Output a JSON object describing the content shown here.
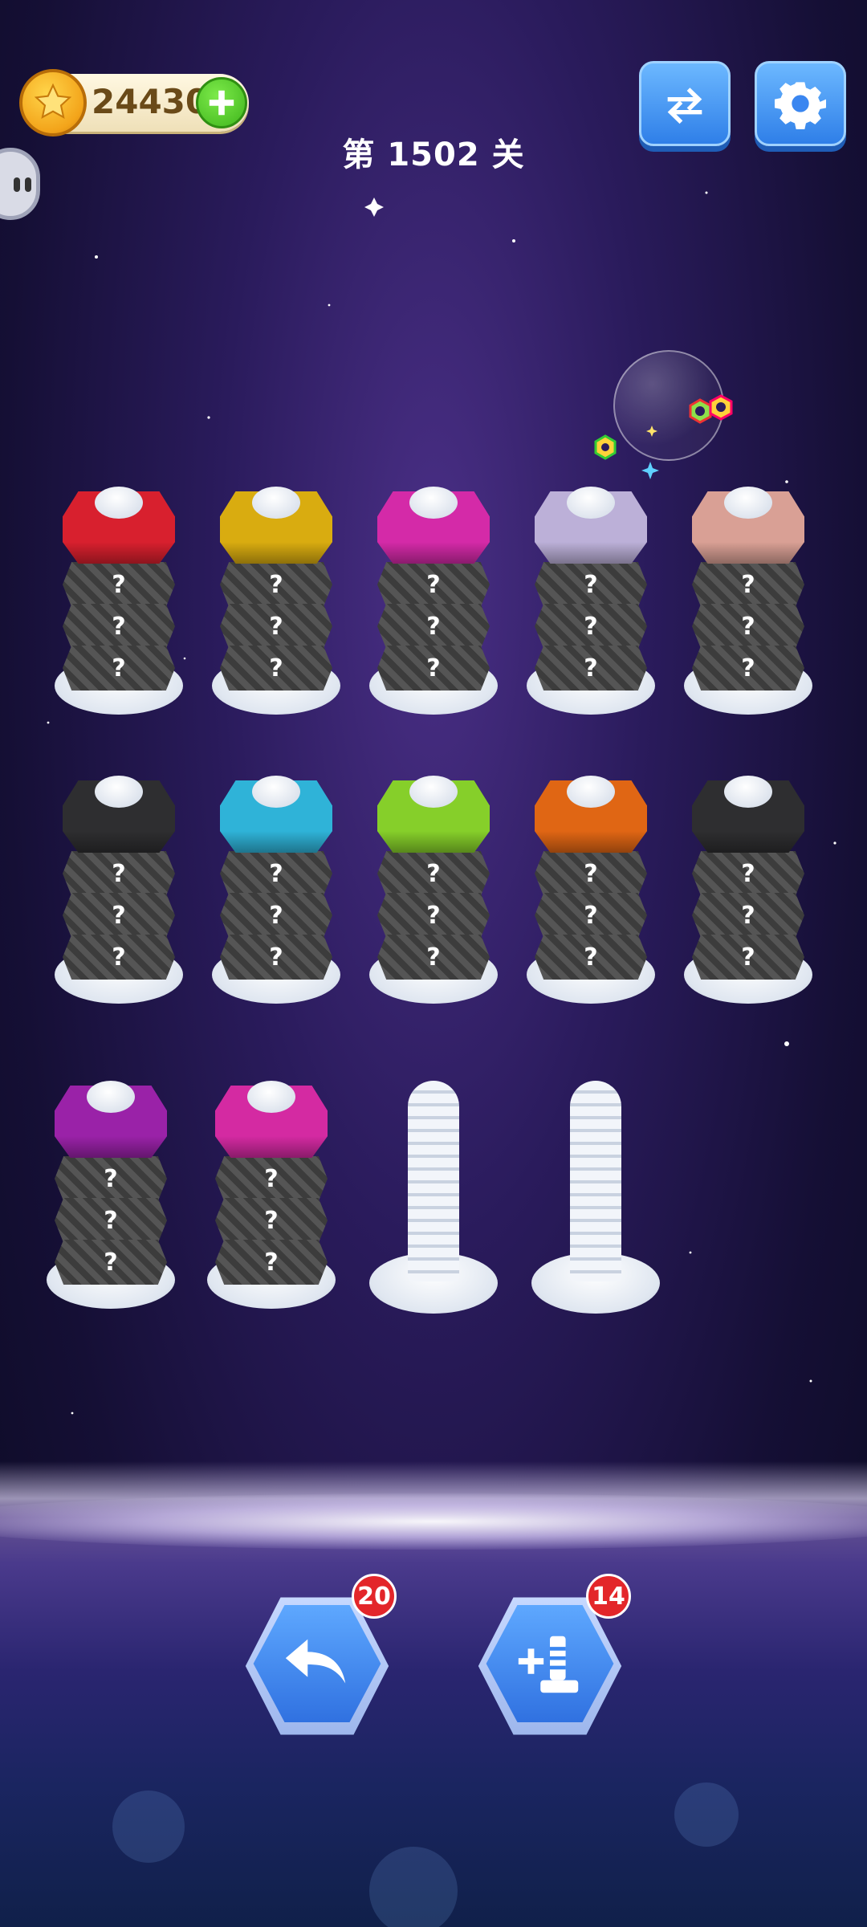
{
  "header": {
    "coins": "24430",
    "level_title": "第 1502 关"
  },
  "icons": {
    "coin": "star-coin-icon",
    "add_coins": "plus-icon",
    "side_menu": "side-menu-tab",
    "refresh": "refresh-icon",
    "settings": "gear-icon",
    "undo": "undo-icon",
    "add_screw": "add-screw-icon"
  },
  "board": {
    "screws": [
      {
        "top_color": "#d8202e",
        "hidden_nuts": [
          "?",
          "?",
          "?"
        ]
      },
      {
        "top_color": "#d9ac10",
        "hidden_nuts": [
          "?",
          "?",
          "?"
        ]
      },
      {
        "top_color": "#d42aa8",
        "hidden_nuts": [
          "?",
          "?",
          "?"
        ]
      },
      {
        "top_color": "#bcb0d8",
        "hidden_nuts": [
          "?",
          "?",
          "?"
        ]
      },
      {
        "top_color": "#d9a095",
        "hidden_nuts": [
          "?",
          "?",
          "?"
        ]
      },
      {
        "top_color": "#2e2e30",
        "hidden_nuts": [
          "?",
          "?",
          "?"
        ]
      },
      {
        "top_color": "#2fb3d8",
        "hidden_nuts": [
          "?",
          "?",
          "?"
        ]
      },
      {
        "top_color": "#86cf2a",
        "hidden_nuts": [
          "?",
          "?",
          "?"
        ]
      },
      {
        "top_color": "#e06614",
        "hidden_nuts": [
          "?",
          "?",
          "?"
        ]
      },
      {
        "top_color": "#2e2e30",
        "hidden_nuts": [
          "?",
          "?",
          "?"
        ]
      },
      {
        "top_color": "#9a22a8",
        "hidden_nuts": [
          "?",
          "?",
          "?"
        ]
      },
      {
        "top_color": "#d42aa2",
        "hidden_nuts": [
          "?",
          "?",
          "?"
        ]
      }
    ],
    "empty_screws": 2
  },
  "actions": {
    "undo_count": "20",
    "add_screw_count": "14"
  }
}
